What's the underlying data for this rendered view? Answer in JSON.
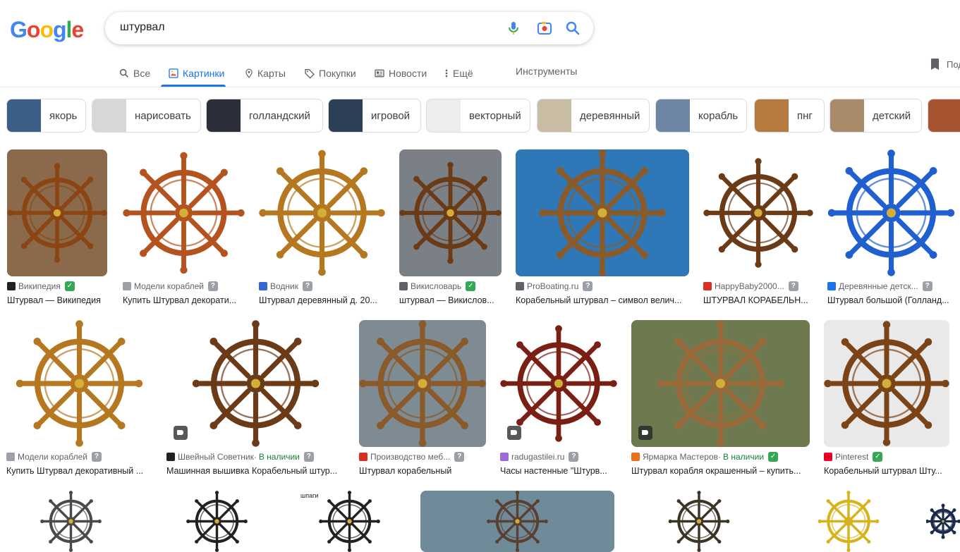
{
  "logo": {
    "letters": [
      "G",
      "o",
      "o",
      "g",
      "l",
      "e"
    ],
    "colors": [
      "#4285F4",
      "#EA4335",
      "#FBBC05",
      "#4285F4",
      "#34A853",
      "#EA4335"
    ]
  },
  "search": {
    "query": "штурвал"
  },
  "tabs": [
    {
      "label": "Все",
      "icon": "search-icon"
    },
    {
      "label": "Картинки",
      "icon": "image-icon"
    },
    {
      "label": "Карты",
      "icon": "map-pin-icon"
    },
    {
      "label": "Покупки",
      "icon": "tag-icon"
    },
    {
      "label": "Новости",
      "icon": "news-icon"
    },
    {
      "label": "Ещё",
      "icon": "more-vert-icon"
    }
  ],
  "tools_label": "Инструменты",
  "saved_label": "Под",
  "chips": [
    {
      "label": "якорь",
      "thumb": "#3b5f86"
    },
    {
      "label": "нарисовать",
      "thumb": "#d7d7d7"
    },
    {
      "label": "голландский",
      "thumb": "#2a2f3a"
    },
    {
      "label": "игровой",
      "thumb": "#2d3f55"
    },
    {
      "label": "векторный",
      "thumb": "#ededed"
    },
    {
      "label": "деревянный",
      "thumb": "#c9bca5"
    },
    {
      "label": "корабль",
      "thumb": "#6e86a6"
    },
    {
      "label": "пнг",
      "thumb": "#b57a3e"
    },
    {
      "label": "детский",
      "thumb": "#a98a6a"
    },
    {
      "label": "",
      "thumb": "#a5542f"
    }
  ],
  "row1": [
    {
      "source": "Википедия",
      "title": "Штурвал — Википедия",
      "fav": "#202124",
      "badge": "verified",
      "bg": "#8a6a4a",
      "wheel": "#8b4513"
    },
    {
      "source": "Модели кораблей",
      "title": "Купить Штурвал декорати...",
      "fav": "#9aa0a6",
      "badge": "question",
      "bg": "#ffffff",
      "wheel": "#b5531f"
    },
    {
      "source": "Водник",
      "title": "Штурвал деревянный д. 20...",
      "fav": "#3367d6",
      "badge": "question",
      "bg": "#ffffff",
      "wheel": "#b5771f"
    },
    {
      "source": "Викисловарь",
      "title": "штурвал — Викислов...",
      "fav": "#5f6368",
      "badge": "verified",
      "bg": "#7b7f86",
      "wheel": "#6b3b18"
    },
    {
      "source": "ProBoating.ru",
      "title": "Корабельный штурвал – символ велич...",
      "fav": "#5f6368",
      "badge": "question",
      "bg": "#2f78b7",
      "wheel": "#8a5a2a"
    },
    {
      "source": "HappyBaby2000...",
      "title": "ШТУРВАЛ КОРАБЕЛЬН...",
      "fav": "#d93025",
      "badge": "question",
      "bg": "#ffffff",
      "wheel": "#6b3b18"
    },
    {
      "source": "Деревянные детск...",
      "title": "Штурвал большой (Голланд...",
      "fav": "#1a73e8",
      "badge": "question",
      "bg": "#ffffff",
      "wheel": "#1f5fcf"
    }
  ],
  "row2": [
    {
      "source": "Модели кораблей",
      "availability": "",
      "title": "Купить Штурвал декоративный ...",
      "fav": "#9aa0a6",
      "badge": "question",
      "bg": "#ffffff",
      "wheel": "#b5771f",
      "tag": false
    },
    {
      "source": "Швейный Советник",
      "availability": "В наличии",
      "title": "Машинная вышивка Корабельный штур...",
      "fav": "#202124",
      "badge": "question",
      "bg": "#ffffff",
      "wheel": "#6b3b18",
      "tag": true
    },
    {
      "source": "Производство меб...",
      "availability": "",
      "title": "Штурвал корабельный",
      "fav": "#d93025",
      "badge": "question",
      "bg": "#7e8b92",
      "wheel": "#8a5a2a",
      "tag": false
    },
    {
      "source": "radugastilei.ru",
      "availability": "",
      "title": "Часы настенные \"Штурв...",
      "fav": "#9c6ad6",
      "badge": "question",
      "bg": "#ffffff",
      "wheel": "#7a1f14",
      "tag": true
    },
    {
      "source": "Ярмарка Мастеров",
      "availability": "В наличии",
      "title": "Штурвал корабля окрашенный – купить...",
      "fav": "#e8711a",
      "badge": "verified",
      "bg": "#6d7a4f",
      "wheel": "#9a6a3a",
      "tag": true
    },
    {
      "source": "Pinterest",
      "availability": "",
      "title": "Корабельный штурвал Шту...",
      "fav": "#e60023",
      "badge": "verified",
      "bg": "#e9e9e9",
      "wheel": "#7a4418",
      "tag": false
    }
  ],
  "row3": [
    {
      "bg": "#ffffff",
      "wheel": "#4a4a4a"
    },
    {
      "bg": "#ffffff",
      "wheel": "#222222"
    },
    {
      "bg": "#ffffff",
      "wheel": "#222222",
      "label": "шпаги"
    },
    {
      "bg": "#6f8a99",
      "wheel": "#5a4030"
    },
    {
      "bg": "#ffffff",
      "wheel": "#3d3428"
    },
    {
      "bg": "#ffffff",
      "wheel": "#d9b21a"
    },
    {
      "bg": "#ffffff",
      "wheel": "#1a2a4a"
    }
  ]
}
